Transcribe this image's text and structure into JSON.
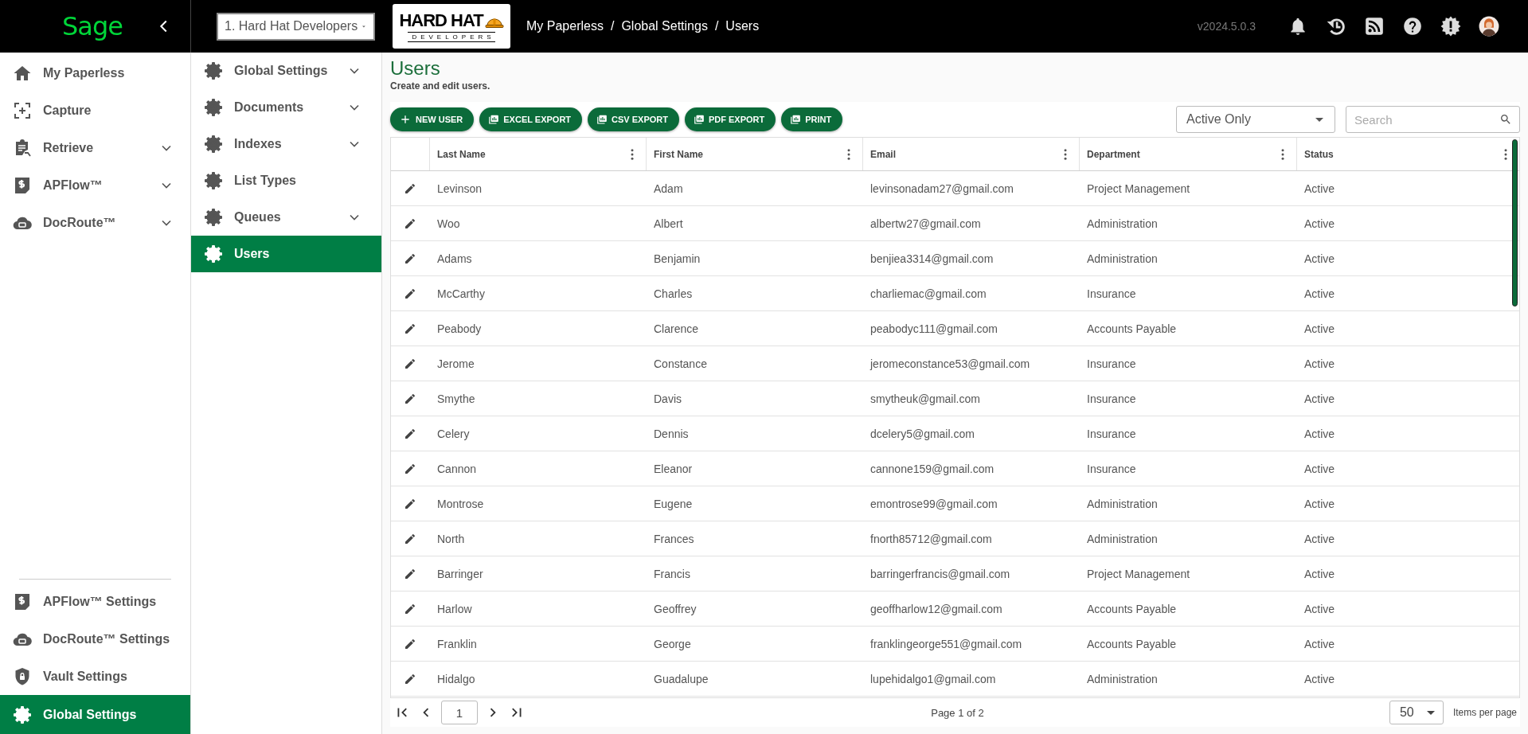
{
  "topbar": {
    "brand": "Sage",
    "company_select": "1. Hard Hat Developers",
    "logo": {
      "title": "HARD HAT",
      "subtitle": "DEVELOPERS"
    },
    "breadcrumb": [
      "My Paperless",
      "Global Settings",
      "Users"
    ],
    "separator": "/",
    "version": "v2024.5.0.3"
  },
  "sidebar": {
    "items": [
      {
        "label": "My Paperless",
        "selected": false
      },
      {
        "label": "Capture",
        "selected": false
      },
      {
        "label": "Retrieve",
        "selected": false,
        "expanded": false
      },
      {
        "label": "APFlow™",
        "selected": false,
        "expanded": false
      },
      {
        "label": "DocRoute™",
        "selected": false,
        "expanded": false
      }
    ],
    "bottom_items": [
      {
        "label": "APFlow™ Settings",
        "selected": false
      },
      {
        "label": "DocRoute™ Settings",
        "selected": false
      },
      {
        "label": "Vault Settings",
        "selected": false
      },
      {
        "label": "Global Settings",
        "selected": true
      }
    ]
  },
  "subnav": {
    "items": [
      {
        "label": "Global Settings",
        "selected": false,
        "expanded": false
      },
      {
        "label": "Documents",
        "selected": false,
        "expanded": false
      },
      {
        "label": "Indexes",
        "selected": false,
        "expanded": false
      },
      {
        "label": "List Types",
        "selected": false
      },
      {
        "label": "Queues",
        "selected": false,
        "expanded": false
      },
      {
        "label": "Users",
        "selected": true
      }
    ]
  },
  "page": {
    "title": "Users",
    "subtitle": "Create and edit users.",
    "buttons": [
      {
        "label": "NEW USER",
        "kind": "add"
      },
      {
        "label": "EXCEL EXPORT",
        "kind": "export"
      },
      {
        "label": "CSV EXPORT",
        "kind": "export"
      },
      {
        "label": "PDF EXPORT",
        "kind": "export"
      },
      {
        "label": "PRINT",
        "kind": "export"
      }
    ],
    "filter": "Active Only",
    "search": {
      "placeholder": "Search"
    },
    "table": {
      "columns": [
        "Last Name",
        "First Name",
        "Email",
        "Department",
        "Status"
      ],
      "rows": [
        [
          "Levinson",
          "Adam",
          "levinsonadam27@gmail.com",
          "Project Management",
          "Active"
        ],
        [
          "Woo",
          "Albert",
          "albertw27@gmail.com",
          "Administration",
          "Active"
        ],
        [
          "Adams",
          "Benjamin",
          "benjiea3314@gmail.com",
          "Administration",
          "Active"
        ],
        [
          "McCarthy",
          "Charles",
          "charliemac@gmail.com",
          "Insurance",
          "Active"
        ],
        [
          "Peabody",
          "Clarence",
          "peabodyc111@gmail.com",
          "Accounts Payable",
          "Active"
        ],
        [
          "Jerome",
          "Constance",
          "jeromeconstance53@gmail.com",
          "Insurance",
          "Active"
        ],
        [
          "Smythe",
          "Davis",
          "smytheuk@gmail.com",
          "Insurance",
          "Active"
        ],
        [
          "Celery",
          "Dennis",
          "dcelery5@gmail.com",
          "Insurance",
          "Active"
        ],
        [
          "Cannon",
          "Eleanor",
          "cannone159@gmail.com",
          "Insurance",
          "Active"
        ],
        [
          "Montrose",
          "Eugene",
          "emontrose99@gmail.com",
          "Administration",
          "Active"
        ],
        [
          "North",
          "Frances",
          "fnorth85712@gmail.com",
          "Administration",
          "Active"
        ],
        [
          "Barringer",
          "Francis",
          "barringerfrancis@gmail.com",
          "Project Management",
          "Active"
        ],
        [
          "Harlow",
          "Geoffrey",
          "geoffharlow12@gmail.com",
          "Accounts Payable",
          "Active"
        ],
        [
          "Franklin",
          "George",
          "franklingeorge551@gmail.com",
          "Accounts Payable",
          "Active"
        ],
        [
          "Hidalgo",
          "Guadalupe",
          "lupehidalgo1@gmail.com",
          "Administration",
          "Active"
        ]
      ]
    },
    "pager": {
      "page": "1",
      "label": "Page 1 of 2",
      "page_size": "50",
      "page_size_label": "Items per page"
    }
  }
}
